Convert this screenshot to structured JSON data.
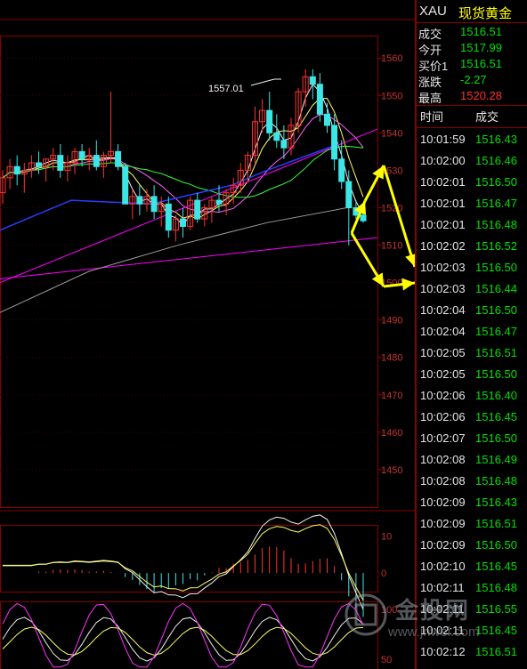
{
  "header": {
    "code": "XAU",
    "name": "现货黄金"
  },
  "quote": [
    {
      "label": "成交",
      "value": "1516.51",
      "color": "#00e000"
    },
    {
      "label": "今开",
      "value": "1517.99",
      "color": "#00e000"
    },
    {
      "label": "买价1",
      "value": "1516.51",
      "color": "#00e000"
    },
    {
      "label": "涨跌",
      "value": "-2.27",
      "color": "#00e000"
    },
    {
      "label": "最高",
      "value": "1520.28",
      "color": "#ff3030"
    }
  ],
  "trades_header": {
    "time": "时间",
    "price": "成交"
  },
  "trades": [
    {
      "time": "10:01:59",
      "price": "1516.43"
    },
    {
      "time": "10:02:00",
      "price": "1516.46"
    },
    {
      "time": "10:02:01",
      "price": "1516.50"
    },
    {
      "time": "10:02:01",
      "price": "1516.47"
    },
    {
      "time": "10:02:01",
      "price": "1516.48"
    },
    {
      "time": "10:02:02",
      "price": "1516.52"
    },
    {
      "time": "10:02:03",
      "price": "1516.50"
    },
    {
      "time": "10:02:03",
      "price": "1516.44"
    },
    {
      "time": "10:02:04",
      "price": "1516.50"
    },
    {
      "time": "10:02:04",
      "price": "1516.47"
    },
    {
      "time": "10:02:05",
      "price": "1516.51"
    },
    {
      "time": "10:02:05",
      "price": "1516.50"
    },
    {
      "time": "10:02:06",
      "price": "1516.40"
    },
    {
      "time": "10:02:06",
      "price": "1516.45"
    },
    {
      "time": "10:02:07",
      "price": "1516.50"
    },
    {
      "time": "10:02:08",
      "price": "1516.49"
    },
    {
      "time": "10:02:08",
      "price": "1516.48"
    },
    {
      "time": "10:02:09",
      "price": "1516.43"
    },
    {
      "time": "10:02:09",
      "price": "1516.51"
    },
    {
      "time": "10:02:09",
      "price": "1516.50"
    },
    {
      "time": "10:02:10",
      "price": "1516.45"
    },
    {
      "time": "10:02:11",
      "price": "1516.48"
    },
    {
      "time": "10:02:11",
      "price": "1516.55"
    },
    {
      "time": "10:02:11",
      "price": "1516.45"
    },
    {
      "time": "10:02:12",
      "price": "1516.51"
    }
  ],
  "watermark": {
    "brand": "金投网",
    "url": "www.jnwei.com"
  },
  "chart_data": [
    {
      "type": "candlestick",
      "ylim": [
        1440,
        1566
      ],
      "yticks": [
        1560,
        1550,
        1540,
        1530,
        1520,
        1510,
        1500,
        1490,
        1480,
        1470,
        1460,
        1450
      ],
      "annotation": "1557.01",
      "candles": [
        [
          1524,
          1530,
          1521,
          1528
        ],
        [
          1528,
          1533,
          1525,
          1531
        ],
        [
          1531,
          1534,
          1526,
          1529
        ],
        [
          1529,
          1532,
          1524,
          1530
        ],
        [
          1530,
          1534,
          1528,
          1532
        ],
        [
          1532,
          1535,
          1529,
          1531
        ],
        [
          1531,
          1533,
          1527,
          1533
        ],
        [
          1533,
          1536,
          1530,
          1534
        ],
        [
          1534,
          1537,
          1528,
          1530
        ],
        [
          1530,
          1534,
          1527,
          1532
        ],
        [
          1532,
          1536,
          1529,
          1535
        ],
        [
          1535,
          1537,
          1531,
          1533
        ],
        [
          1533,
          1536,
          1530,
          1534
        ],
        [
          1534,
          1538,
          1530,
          1531
        ],
        [
          1531,
          1535,
          1528,
          1534
        ],
        [
          1534,
          1551,
          1532,
          1535
        ],
        [
          1535,
          1537,
          1530,
          1531
        ],
        [
          1531,
          1532,
          1521,
          1521
        ],
        [
          1521,
          1525,
          1517,
          1523
        ],
        [
          1523,
          1526,
          1518,
          1521
        ],
        [
          1521,
          1525,
          1519,
          1523
        ],
        [
          1523,
          1526,
          1517,
          1519
        ],
        [
          1519,
          1523,
          1515,
          1521
        ],
        [
          1521,
          1523,
          1512,
          1514
        ],
        [
          1514,
          1518,
          1511,
          1517
        ],
        [
          1517,
          1520,
          1512,
          1515
        ],
        [
          1515,
          1523,
          1514,
          1522
        ],
        [
          1522,
          1524,
          1516,
          1517
        ],
        [
          1517,
          1521,
          1515,
          1520
        ],
        [
          1520,
          1523,
          1516,
          1522
        ],
        [
          1522,
          1526,
          1519,
          1521
        ],
        [
          1521,
          1525,
          1518,
          1524
        ],
        [
          1524,
          1528,
          1521,
          1526
        ],
        [
          1526,
          1532,
          1524,
          1530
        ],
        [
          1530,
          1535,
          1527,
          1534
        ],
        [
          1534,
          1547,
          1532,
          1543
        ],
        [
          1543,
          1549,
          1540,
          1546
        ],
        [
          1546,
          1551,
          1538,
          1540
        ],
        [
          1540,
          1545,
          1536,
          1538
        ],
        [
          1538,
          1542,
          1533,
          1536
        ],
        [
          1536,
          1544,
          1534,
          1542
        ],
        [
          1542,
          1552,
          1540,
          1551
        ],
        [
          1551,
          1557,
          1547,
          1555
        ],
        [
          1555,
          1557,
          1549,
          1553
        ],
        [
          1553,
          1556,
          1543,
          1545
        ],
        [
          1545,
          1548,
          1540,
          1542
        ],
        [
          1542,
          1545,
          1530,
          1533
        ],
        [
          1533,
          1538,
          1525,
          1527
        ],
        [
          1527,
          1530,
          1510,
          1520
        ],
        [
          1520,
          1522,
          1517,
          1518
        ],
        [
          1518,
          1521,
          1516,
          1516.5
        ]
      ]
    },
    {
      "type": "bar",
      "ylim": [
        -5,
        13
      ],
      "yticks": [
        10,
        0
      ]
    },
    {
      "type": "line",
      "ylim": [
        40,
        108
      ],
      "yticks": [
        100,
        50
      ]
    }
  ]
}
